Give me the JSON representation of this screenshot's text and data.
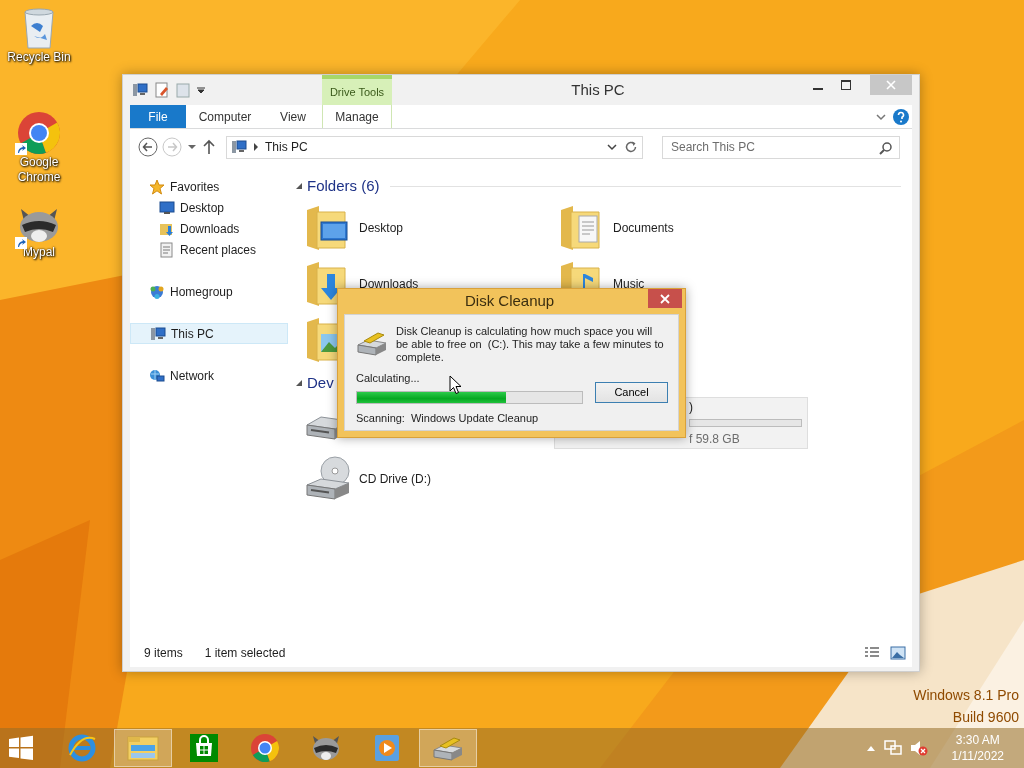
{
  "desktop": {
    "icons": [
      {
        "kind": "recycle",
        "label": "Recycle Bin",
        "shortcut": false
      },
      {
        "kind": "chrome",
        "label": "Google Chrome",
        "shortcut": true
      },
      {
        "kind": "raccoon",
        "label": "Mypal",
        "shortcut": true
      }
    ],
    "watermark": [
      "Windows 8.1 Pro",
      "Build 9600"
    ]
  },
  "explorer": {
    "title": "This PC",
    "context_group": "Drive Tools",
    "ribbon_tabs": [
      {
        "label": "File",
        "kind": "file",
        "selected": false
      },
      {
        "label": "Computer",
        "kind": "tab",
        "selected": false
      },
      {
        "label": "View",
        "kind": "tab",
        "selected": false
      },
      {
        "label": "Manage",
        "kind": "context",
        "selected": false
      }
    ],
    "address": "This PC",
    "search": {
      "placeholder": "Search This PC"
    },
    "nav": [
      {
        "label": "Favorites",
        "kind": "star",
        "selected": false,
        "children": [
          {
            "label": "Desktop",
            "kind": "desktop",
            "selected": false
          },
          {
            "label": "Downloads",
            "kind": "downloads",
            "selected": false
          },
          {
            "label": "Recent places",
            "kind": "recent",
            "selected": false
          }
        ]
      },
      {
        "label": "Homegroup",
        "kind": "homegroup",
        "selected": false
      },
      {
        "label": "This PC",
        "kind": "pc",
        "selected": true
      },
      {
        "label": "Network",
        "kind": "network",
        "selected": false
      }
    ],
    "sections": [
      {
        "title": "Folders (6)",
        "expanded": true,
        "items": [
          {
            "label": "Desktop",
            "kind": "desktop",
            "selected": false
          },
          {
            "label": "Documents",
            "kind": "documents",
            "selected": false
          },
          {
            "label": "Downloads",
            "kind": "downloads",
            "selected": false
          },
          {
            "label": "Music",
            "kind": "music",
            "selected": false
          },
          {
            "kind": "pictures",
            "selected": false
          }
        ]
      },
      {
        "title": "Dev",
        "expanded": true,
        "items": [
          {
            "kind": "hdd",
            "selected": false
          },
          {
            "label": ")",
            "detail": "f 59.8 GB",
            "selected": true
          },
          {
            "kind": "cd",
            "label": "CD Drive (D:)",
            "selected": false
          }
        ]
      }
    ],
    "status": {
      "count": "9 items",
      "selection": "1 item selected"
    }
  },
  "dialog": {
    "title": "Disk Cleanup",
    "message": "Disk Cleanup is calculating how much space you will be able to free on  (C:). This may take a few minutes to complete.",
    "status": "Calculating...",
    "progress": {
      "level": 0.66
    },
    "button": "Cancel",
    "scan_label": "Scanning:",
    "scan_item": "Windows Update Cleanup"
  },
  "taskbar": {
    "apps": [
      {
        "kind": "ie",
        "active": false
      },
      {
        "kind": "explorer",
        "active": true
      },
      {
        "kind": "store",
        "active": false
      },
      {
        "kind": "chrome",
        "active": false
      },
      {
        "kind": "raccoon",
        "active": false
      },
      {
        "kind": "media",
        "active": false
      },
      {
        "kind": "cleanup",
        "active": true
      }
    ],
    "volume_muted": true,
    "time": "3:30 AM",
    "date": "1/11/2022"
  }
}
